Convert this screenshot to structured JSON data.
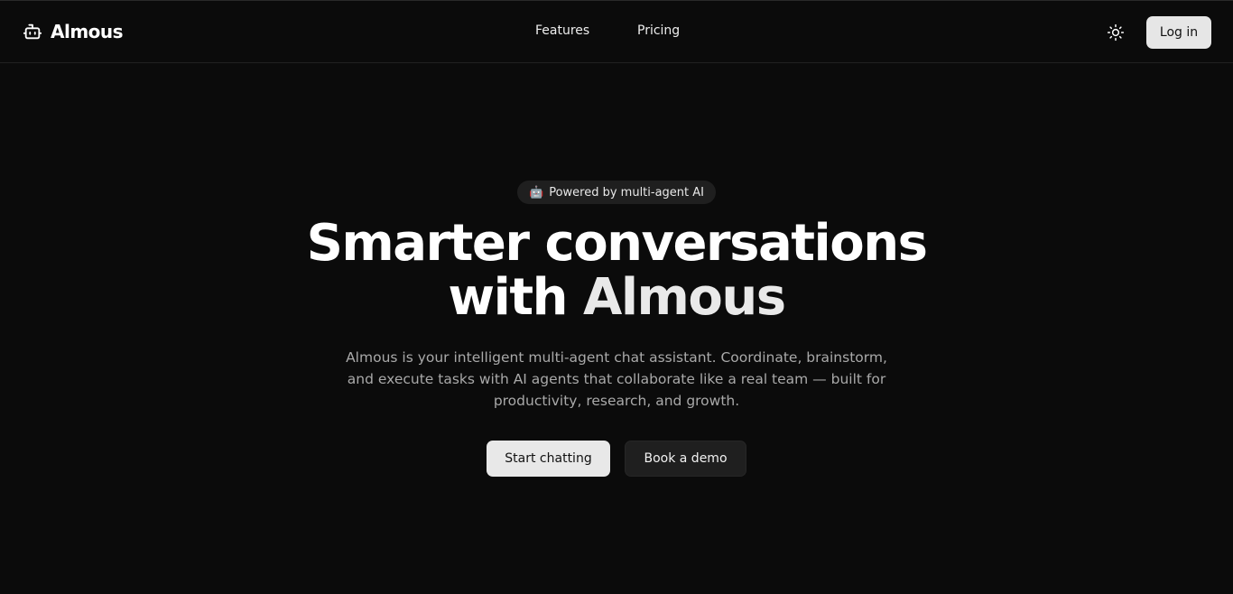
{
  "header": {
    "brand": {
      "name": "Almous",
      "icon": "robot-icon"
    },
    "nav": [
      {
        "label": "Features"
      },
      {
        "label": "Pricing"
      }
    ],
    "theme_toggle_icon": "sun-icon",
    "login_label": "Log in"
  },
  "hero": {
    "badge": {
      "emoji": "🤖",
      "text": "Powered by multi-agent AI"
    },
    "title_line1": "Smarter conversations",
    "title_line2_prefix": "with",
    "title_line2_brand": "Almous",
    "subtitle": "Almous is your intelligent multi-agent chat assistant. Coordinate, brainstorm, and execute tasks with AI agents that collaborate like a real team — built for productivity, research, and growth.",
    "primary_cta": "Start chatting",
    "secondary_cta": "Book a demo"
  },
  "colors": {
    "background": "#0b0b0b",
    "text": "#ffffff",
    "muted_text": "#a9a9a9",
    "button_light": "#e8e8e8",
    "button_dark": "#1f1f1f"
  }
}
